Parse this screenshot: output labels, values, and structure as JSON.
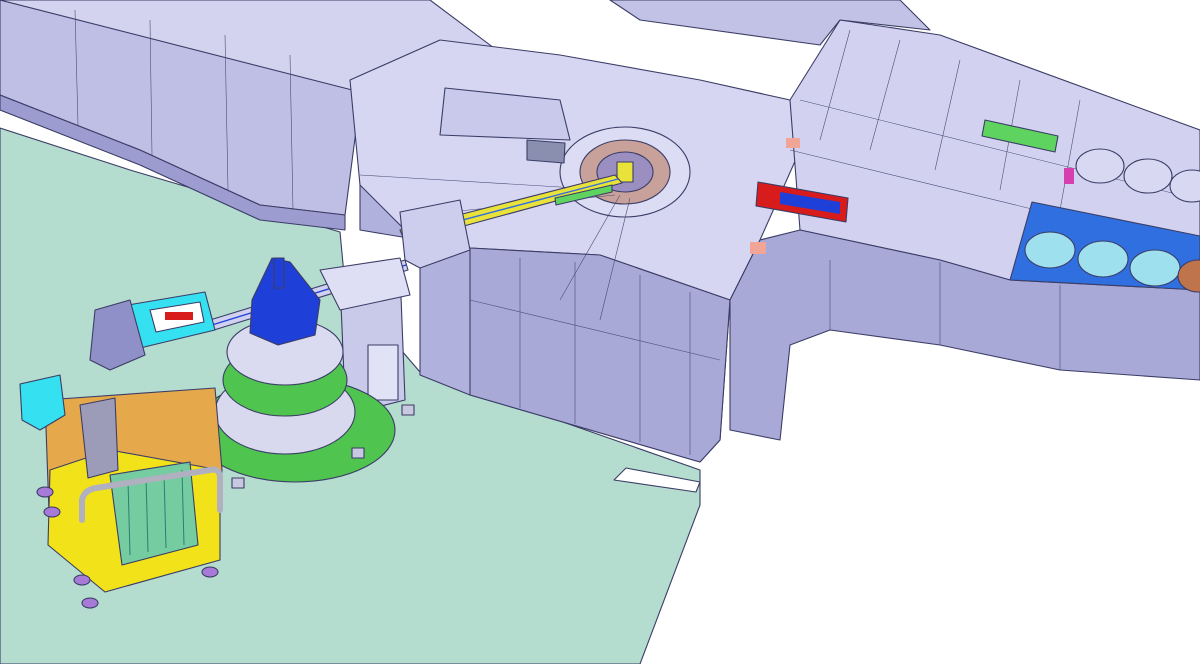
{
  "scene": {
    "title": "",
    "colors": {
      "background": "#ffffff",
      "floor": "#b4dccf",
      "shielding_light": "#d6d6f2",
      "shielding_mid": "#bfbfe6",
      "shielding_dark": "#a6a6d6",
      "edge": "#3b3d66",
      "water_channel": "#2f6fe0",
      "dipole_red": "#d81b1b",
      "beam_yellow": "#e8e23a",
      "beam_green": "#5fd35f",
      "sample_blue": "#1f3fd9",
      "table_green": "#4fc44f",
      "frame_yellow": "#f2e21a",
      "frame_orange": "#e5a84a",
      "cyan_magnet": "#35e0f0",
      "caster_violet": "#a77ad8"
    },
    "parts": [
      "target-monolith",
      "shielding-bunker",
      "moderator-wheel",
      "guide-channels",
      "neutron-beamline",
      "goniometer-table",
      "detector-cart",
      "floor-plate"
    ]
  }
}
